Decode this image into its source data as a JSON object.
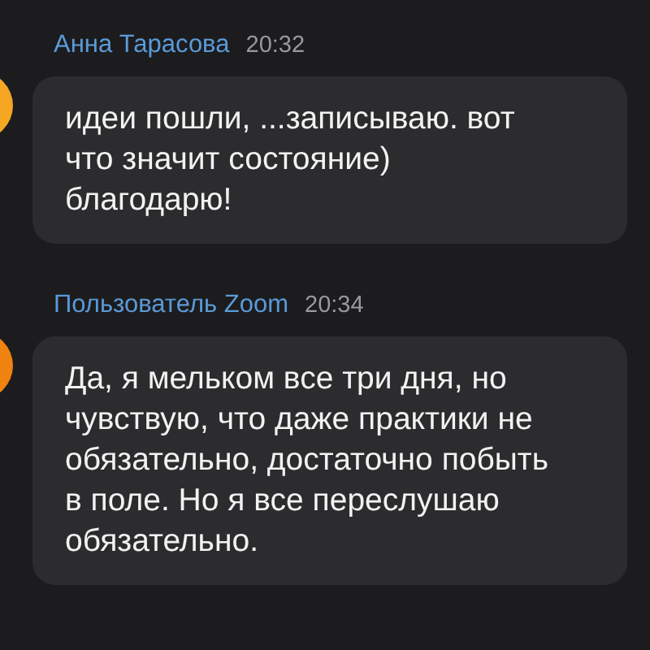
{
  "messages": [
    {
      "sender": "Анна Тарасова",
      "time": "20:32",
      "color": "#f5a623",
      "lines": [
        "идеи пошли, ...записываю. вот",
        "что значит состояние)",
        "благодарю!"
      ]
    },
    {
      "sender": "Пользователь Zoom",
      "time": "20:34",
      "color": "#f0820f",
      "lines": [
        "Да, я мельком все три дня, но",
        "чувствую, что даже практики не",
        "обязательно, достаточно побыть",
        "в поле. Но я все переслушаю",
        "обязательно."
      ]
    }
  ]
}
